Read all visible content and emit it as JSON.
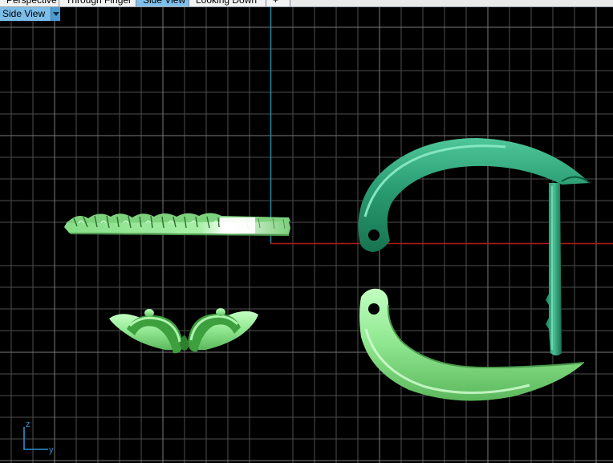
{
  "window": {
    "title": "Side View"
  },
  "tabs": [
    {
      "label": "Perspective",
      "active": false
    },
    {
      "label": "Through Finger",
      "active": false
    },
    {
      "label": "Side View",
      "active": true
    },
    {
      "label": "Looking Down",
      "active": false
    },
    {
      "label": "+",
      "active": false
    }
  ],
  "view_selector": {
    "value": "Side View",
    "icon": "chevron-down-icon"
  },
  "axis_indicator": {
    "vertical_label": "z",
    "horizontal_label": "y"
  },
  "colors": {
    "background": "#000000",
    "grid": "#5a5a5a",
    "axis_vertical": "#1e8aa3",
    "axis_horizontal": "#b11a1a",
    "model_dark_green": "#2faa7e",
    "model_light_green": "#8fe88f",
    "accent_blue": "#7cbde9"
  },
  "scene_objects": [
    {
      "name": "ring-band-flat"
    },
    {
      "name": "ring-crown-twist"
    },
    {
      "name": "clasp-upper-arc"
    },
    {
      "name": "clasp-lower-arc"
    },
    {
      "name": "clasp-pin"
    }
  ]
}
